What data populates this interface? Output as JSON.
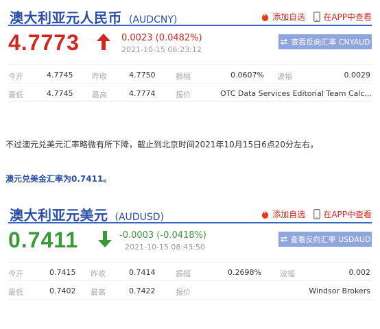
{
  "colors": {
    "up": "#d0281e",
    "down": "#3a9a3a",
    "accent": "#2a4ea3"
  },
  "actions": {
    "add_watch": "添加自选",
    "view_in_app": "在APP中查看"
  },
  "audcny": {
    "name": "澳大利亚元人民币",
    "code": "(AUDCNY)",
    "price": "4.7773",
    "direction": "up",
    "change": "0.0023 (0.0482%)",
    "time": "2021-10-15 06:23:12",
    "reverse_label": "查看反向汇率 CNYAUD",
    "stats": {
      "open_label": "今开",
      "open": "4.7745",
      "prev_label": "昨收",
      "prev": "4.7750",
      "amp_label": "振幅",
      "amp": "0.0607%",
      "wave_label": "波幅",
      "wave": "0.0029",
      "low_label": "最低",
      "low": "4.7745",
      "high_label": "最高",
      "high": "4.7774",
      "quote_label": "报价",
      "quote": "OTC Data Services Editorial Team Calc..."
    }
  },
  "text1": "不过澳元兑美元汇率略微有所下降，截止到北京时间2021年10月15日6点20分左右，",
  "text2": "澳元兑美金汇率为0.7411。",
  "audusd": {
    "name": "澳大利亚元美元",
    "code": "(AUDUSD)",
    "price": "0.7411",
    "direction": "down",
    "change": "-0.0003 (-0.0418%)",
    "time": "2021-10-15 08:43:50",
    "reverse_label": "查看反向汇率 USDAUD",
    "stats": {
      "open_label": "今开",
      "open": "0.7415",
      "prev_label": "昨收",
      "prev": "0.7414",
      "amp_label": "振幅",
      "amp": "0.2698%",
      "wave_label": "波幅",
      "wave": "0.002",
      "low_label": "最低",
      "low": "0.7402",
      "high_label": "最高",
      "high": "0.7422",
      "quote_label": "报价",
      "quote": "Windsor Brokers"
    }
  }
}
